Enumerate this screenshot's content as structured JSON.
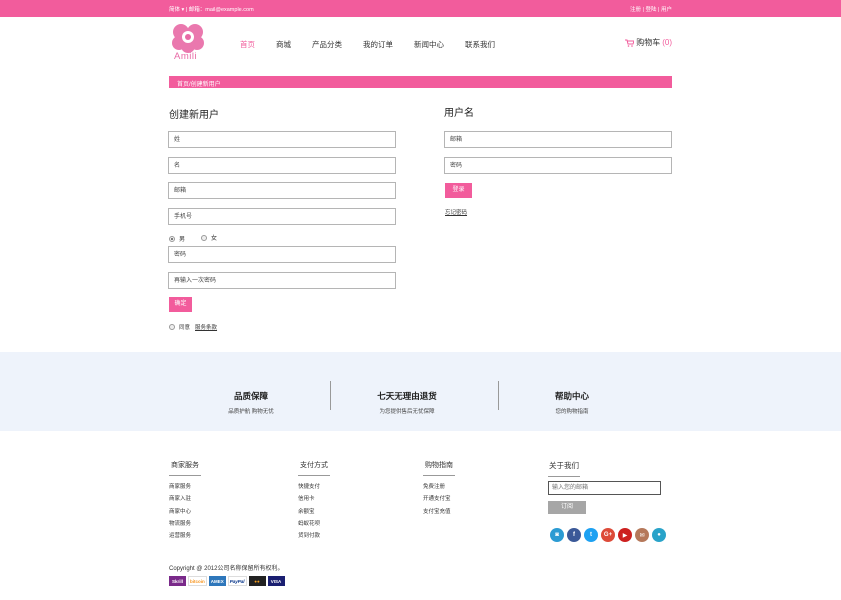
{
  "topbar": {
    "left": "简体 ▾ | 邮箱：mail@example.com",
    "right": "注册 | 登陆 | 用户"
  },
  "brand": {
    "name": "Amili",
    "color": "#f25c9c"
  },
  "nav": [
    "首页",
    "商城",
    "产品分类",
    "我的订单",
    "新闻中心",
    "联系我们"
  ],
  "cart": {
    "label": "购物车",
    "count": "(0)"
  },
  "breadcrumb": "首页/创建新用户",
  "register": {
    "title": "创建新用户",
    "fields": {
      "surname": "姓",
      "given_name": "名",
      "email": "邮箱",
      "phone": "手机号",
      "password": "密码",
      "confirm_password": "再输入一次密码"
    },
    "gender": {
      "male": "男",
      "female": "女",
      "selected": "男"
    },
    "submit": "确定",
    "agree": "同意",
    "terms": "服务条款"
  },
  "login": {
    "title": "用户名",
    "email": "邮箱",
    "password": "密码",
    "submit": "登录",
    "forgot": "忘记密码"
  },
  "features": [
    {
      "title": "品质保障",
      "subtitle": "品质护航 购物无忧"
    },
    {
      "title": "七天无理由退货",
      "subtitle": "为您提供售后无忧保障"
    },
    {
      "title": "帮助中心",
      "subtitle": "您的购物指南"
    }
  ],
  "footer": {
    "columns": [
      {
        "title": "商家服务",
        "items": [
          "商家服务",
          "商家入驻",
          "商家中心",
          "物流服务",
          "运营服务"
        ]
      },
      {
        "title": "支付方式",
        "items": [
          "快捷支付",
          "信用卡",
          "余额宝",
          "蚂蚁花呗",
          "货到付款"
        ]
      },
      {
        "title": "购物指南",
        "items": [
          "免费注册",
          "开通支付宝",
          "支付宝充值"
        ]
      }
    ],
    "about": {
      "title": "关于我们",
      "subscribe_placeholder": "输入您的邮箱",
      "subscribe_button": "订阅"
    },
    "social_icons": [
      {
        "name": "instagram-icon",
        "glyph": "◙",
        "color": "#2b9bd3"
      },
      {
        "name": "facebook-icon",
        "glyph": "f",
        "color": "#3b5998"
      },
      {
        "name": "twitter-icon",
        "glyph": "t",
        "color": "#1da1f2"
      },
      {
        "name": "google-plus-icon",
        "glyph": "G+",
        "color": "#dd4b39"
      },
      {
        "name": "youtube-icon",
        "glyph": "▶",
        "color": "#cd201f"
      },
      {
        "name": "email-icon",
        "glyph": "✉",
        "color": "#b5785a"
      },
      {
        "name": "location-icon",
        "glyph": "●",
        "color": "#29a3c9"
      }
    ],
    "copyright": "Copyright @ 2012公司名称保留所有权利。",
    "payments": [
      "Skrill",
      "bitcoin",
      "AMEX",
      "PayPal",
      "●●",
      "VISA"
    ]
  }
}
